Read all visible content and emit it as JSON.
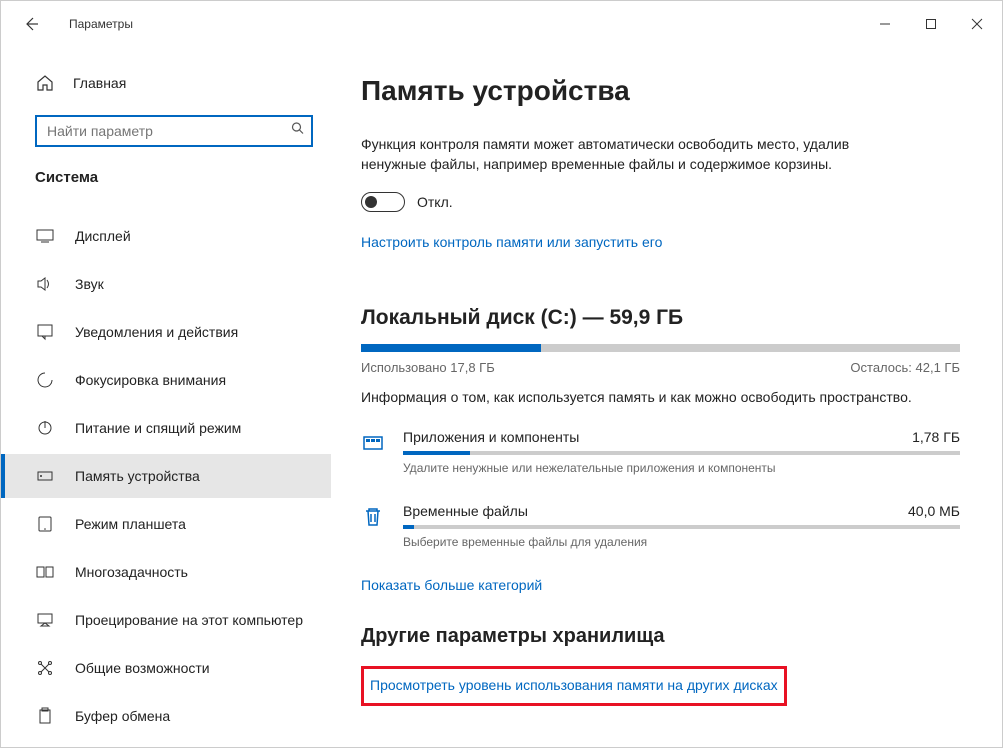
{
  "window": {
    "title": "Параметры"
  },
  "sidebar": {
    "home_label": "Главная",
    "search_placeholder": "Найти параметр",
    "section": "Система",
    "items": [
      {
        "label": "Дисплей"
      },
      {
        "label": "Звук"
      },
      {
        "label": "Уведомления и действия"
      },
      {
        "label": "Фокусировка внимания"
      },
      {
        "label": "Питание и спящий режим"
      },
      {
        "label": "Память устройства"
      },
      {
        "label": "Режим планшета"
      },
      {
        "label": "Многозадачность"
      },
      {
        "label": "Проецирование на этот компьютер"
      },
      {
        "label": "Общие возможности"
      },
      {
        "label": "Буфер обмена"
      }
    ]
  },
  "main": {
    "title": "Память устройства",
    "description": "Функция контроля памяти может автоматически освободить место, удалив ненужные файлы, например временные файлы и содержимое корзины.",
    "toggle_label": "Откл.",
    "configure_link": "Настроить контроль памяти или запустить его",
    "disk": {
      "title": "Локальный диск (C:) — 59,9 ГБ",
      "used_label": "Использовано 17,8 ГБ",
      "free_label": "Осталось: 42,1 ГБ",
      "fill_pct": 30,
      "info": "Информация о том, как используется память и как можно освободить пространство."
    },
    "categories": [
      {
        "name": "Приложения и компоненты",
        "size": "1,78 ГБ",
        "sub": "Удалите ненужные или нежелательные приложения и компоненты",
        "fill_pct": 12
      },
      {
        "name": "Временные файлы",
        "size": "40,0 МБ",
        "sub": "Выберите временные файлы для удаления",
        "fill_pct": 2
      }
    ],
    "more_link": "Показать больше категорий",
    "other_section": "Другие параметры хранилища",
    "other_link": "Просмотреть уровень использования памяти на других дисках"
  }
}
